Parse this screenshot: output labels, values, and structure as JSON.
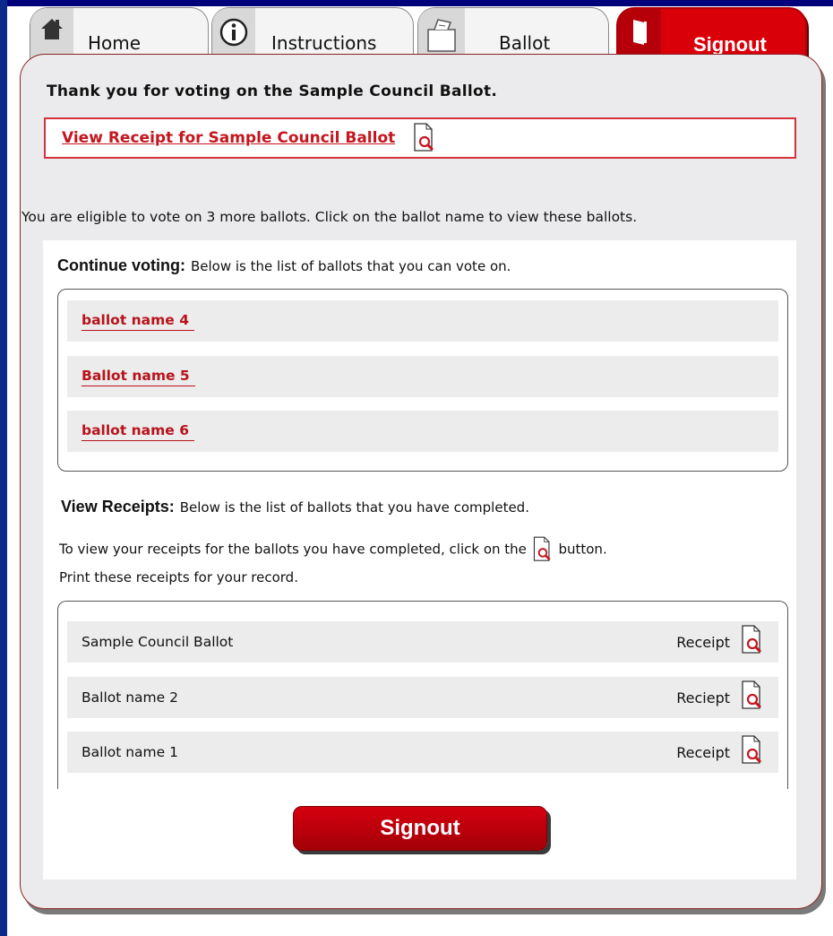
{
  "tabs": {
    "home": "Home",
    "instructions": "Instructions",
    "ballot": "Ballot",
    "signout": "Signout"
  },
  "thanks_message": "Thank you for voting on the Sample Council Ballot.",
  "receipt_link": "View  Receipt  for Sample Council Ballot",
  "eligible_message": "You are eligible to vote on 3 more ballots. Click on the ballot name to view these ballots.",
  "continue_voting": {
    "heading": "Continue voting:",
    "description": "Below is the list of ballots that you can vote on.",
    "ballots": [
      "ballot name 4",
      "Ballot name 5",
      "ballot name 6"
    ]
  },
  "view_receipts": {
    "heading": "View Receipts:",
    "description": "Below is the list of ballots that you have completed.",
    "line2_before": "To view your receipts for the ballots you have completed, click on the",
    "line2_after": "button.",
    "line3": "Print these receipts for your record.",
    "rows": [
      {
        "name": "Sample Council Ballot",
        "label": "Receipt"
      },
      {
        "name": "Ballot name 2",
        "label": "Reciept"
      },
      {
        "name": "Ballot name 1",
        "label": "Receipt"
      }
    ]
  },
  "signout_button": "Signout",
  "colors": {
    "accent_red": "#c4161e",
    "frame_blue": "#00007a",
    "panel_gray": "#ebebed"
  }
}
